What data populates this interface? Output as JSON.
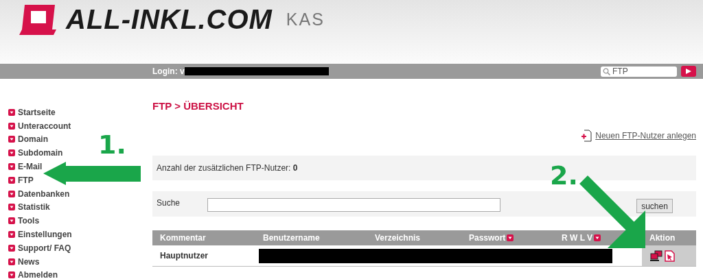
{
  "header": {
    "logo": "ALL-INKL.COM",
    "product": "KAS"
  },
  "topbar": {
    "login_label": "Login: v",
    "search": {
      "value": "FTP"
    }
  },
  "sidebar": {
    "items": [
      {
        "label": "Startseite"
      },
      {
        "label": "Unteraccount"
      },
      {
        "label": "Domain"
      },
      {
        "label": "Subdomain"
      },
      {
        "label": "E-Mail"
      },
      {
        "label": "FTP"
      },
      {
        "label": "Datenbanken"
      },
      {
        "label": "Statistik"
      },
      {
        "label": "Tools"
      },
      {
        "label": "Einstellungen"
      },
      {
        "label": "Support/ FAQ"
      },
      {
        "label": "News"
      },
      {
        "label": "Abmelden"
      }
    ]
  },
  "page_title": "FTP > ÜBERSICHT",
  "new_user_link": "Neuen FTP-Nutzer anlegen",
  "info": {
    "label": "Anzahl der zusätzlichen FTP-Nutzer:",
    "count": "0"
  },
  "search": {
    "label": "Suche",
    "button": "suchen"
  },
  "table": {
    "columns": [
      {
        "label": "Kommentar",
        "help": false
      },
      {
        "label": "Benutzername",
        "help": false
      },
      {
        "label": "Verzeichnis",
        "help": false
      },
      {
        "label": "Passwort",
        "help": true
      },
      {
        "label": "R W L V",
        "help": true
      },
      {
        "label": "Aktion",
        "help": false
      }
    ],
    "rows": [
      {
        "comment": "Hauptnutzer"
      }
    ]
  },
  "annotations": [
    {
      "label": "1."
    },
    {
      "label": "2."
    }
  ]
}
